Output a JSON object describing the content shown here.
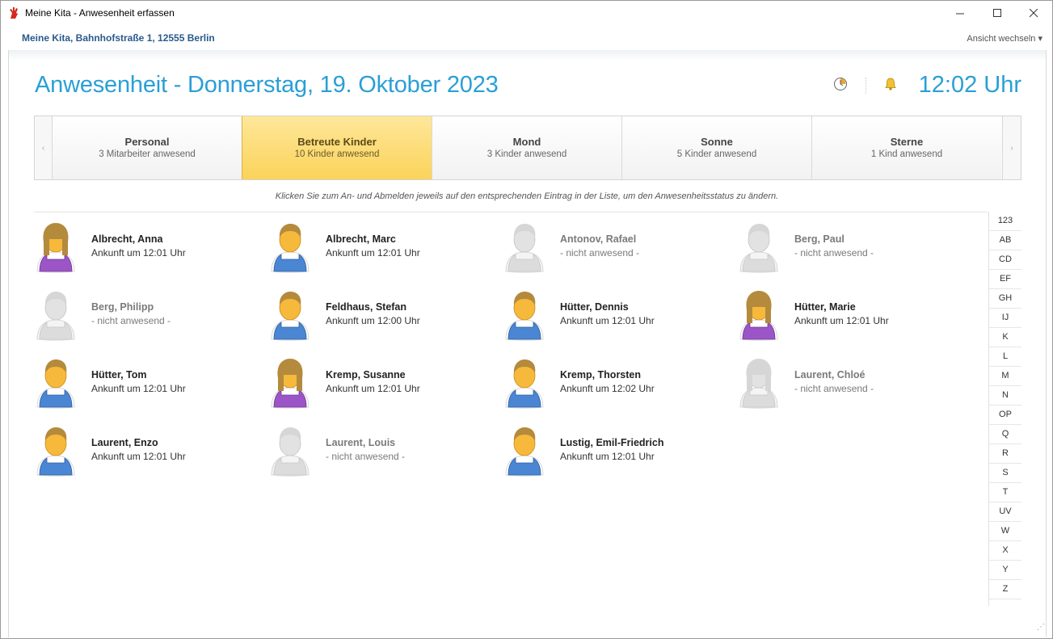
{
  "window": {
    "title": "Meine Kita - Anwesenheit erfassen",
    "minimize": "—",
    "maximize": "☐",
    "close": "✕"
  },
  "subheader": {
    "kita": "Meine Kita, Bahnhofstraße 1, 12555 Berlin",
    "view_switch": "Ansicht wechseln  ▾"
  },
  "header": {
    "title": "Anwesenheit - Donnerstag, 19. Oktober 2023",
    "time": "12:02 Uhr",
    "icons": [
      "clock-pie-icon",
      "bell-icon"
    ]
  },
  "tabs": [
    {
      "name": "Personal",
      "sub": "3 Mitarbeiter anwesend",
      "active": false
    },
    {
      "name": "Betreute Kinder",
      "sub": "10 Kinder anwesend",
      "active": true
    },
    {
      "name": "Mond",
      "sub": "3 Kinder anwesend",
      "active": false
    },
    {
      "name": "Sonne",
      "sub": "5 Kinder anwesend",
      "active": false
    },
    {
      "name": "Sterne",
      "sub": "1 Kind anwesend",
      "active": false
    }
  ],
  "tab_arrows": {
    "left": "‹",
    "right": "›"
  },
  "hint": "Klicken Sie zum An- und Abmelden jeweils auf den entsprechenden Eintrag in der Liste, um den Anwesenheitsstatus zu ändern.",
  "children": [
    {
      "name": "Albrecht, Anna",
      "status": "Ankunft um 12:01 Uhr",
      "present": true,
      "gender": "f"
    },
    {
      "name": "Albrecht, Marc",
      "status": "Ankunft um 12:01 Uhr",
      "present": true,
      "gender": "m"
    },
    {
      "name": "Antonov, Rafael",
      "status": "- nicht anwesend -",
      "present": false,
      "gender": "m"
    },
    {
      "name": "Berg, Paul",
      "status": "- nicht anwesend -",
      "present": false,
      "gender": "m"
    },
    {
      "name": "Berg, Philipp",
      "status": "- nicht anwesend -",
      "present": false,
      "gender": "m"
    },
    {
      "name": "Feldhaus, Stefan",
      "status": "Ankunft um 12:00 Uhr",
      "present": true,
      "gender": "m"
    },
    {
      "name": "Hütter, Dennis",
      "status": "Ankunft um 12:01 Uhr",
      "present": true,
      "gender": "m"
    },
    {
      "name": "Hütter, Marie",
      "status": "Ankunft um 12:01 Uhr",
      "present": true,
      "gender": "f"
    },
    {
      "name": "Hütter, Tom",
      "status": "Ankunft um 12:01 Uhr",
      "present": true,
      "gender": "m"
    },
    {
      "name": "Kremp, Susanne",
      "status": "Ankunft um 12:01 Uhr",
      "present": true,
      "gender": "f"
    },
    {
      "name": "Kremp, Thorsten",
      "status": "Ankunft um 12:02 Uhr",
      "present": true,
      "gender": "m"
    },
    {
      "name": "Laurent, Chloé",
      "status": "- nicht anwesend -",
      "present": false,
      "gender": "f"
    },
    {
      "name": "Laurent, Enzo",
      "status": "Ankunft um 12:01 Uhr",
      "present": true,
      "gender": "m"
    },
    {
      "name": "Laurent, Louis",
      "status": "- nicht anwesend -",
      "present": false,
      "gender": "m"
    },
    {
      "name": "Lustig, Emil-Friedrich",
      "status": "Ankunft um 12:01 Uhr",
      "present": true,
      "gender": "m"
    }
  ],
  "alphabet_index": [
    "123",
    "AB",
    "CD",
    "EF",
    "GH",
    "IJ",
    "K",
    "L",
    "M",
    "N",
    "OP",
    "Q",
    "R",
    "S",
    "T",
    "UV",
    "W",
    "X",
    "Y",
    "Z"
  ],
  "colors": {
    "accent": "#2a9fd6",
    "active_tab": "#fcd35a",
    "male_shirt": "#4a86d4",
    "female_shirt": "#9b55c6",
    "absent": "#d8d8d8"
  }
}
